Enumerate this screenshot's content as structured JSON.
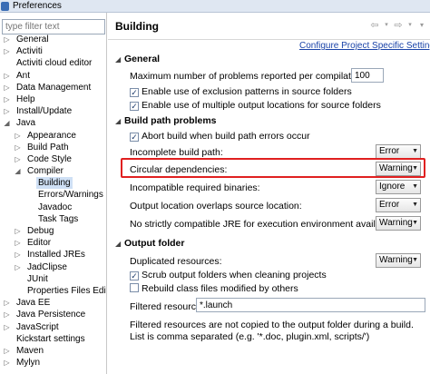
{
  "window": {
    "title": "Preferences"
  },
  "filter": {
    "placeholder": "type filter text"
  },
  "tree": [
    {
      "label": "General",
      "depth": 0,
      "arrow": "▷"
    },
    {
      "label": "Activiti",
      "depth": 0,
      "arrow": "▷"
    },
    {
      "label": "Activiti cloud editor",
      "depth": 0,
      "arrow": ""
    },
    {
      "label": "Ant",
      "depth": 0,
      "arrow": "▷"
    },
    {
      "label": "Data Management",
      "depth": 0,
      "arrow": "▷"
    },
    {
      "label": "Help",
      "depth": 0,
      "arrow": "▷"
    },
    {
      "label": "Install/Update",
      "depth": 0,
      "arrow": "▷"
    },
    {
      "label": "Java",
      "depth": 0,
      "arrow": "◢"
    },
    {
      "label": "Appearance",
      "depth": 1,
      "arrow": "▷"
    },
    {
      "label": "Build Path",
      "depth": 1,
      "arrow": "▷"
    },
    {
      "label": "Code Style",
      "depth": 1,
      "arrow": "▷"
    },
    {
      "label": "Compiler",
      "depth": 1,
      "arrow": "◢"
    },
    {
      "label": "Building",
      "depth": 2,
      "arrow": "",
      "selected": true
    },
    {
      "label": "Errors/Warnings",
      "depth": 2,
      "arrow": ""
    },
    {
      "label": "Javadoc",
      "depth": 2,
      "arrow": ""
    },
    {
      "label": "Task Tags",
      "depth": 2,
      "arrow": ""
    },
    {
      "label": "Debug",
      "depth": 1,
      "arrow": "▷"
    },
    {
      "label": "Editor",
      "depth": 1,
      "arrow": "▷"
    },
    {
      "label": "Installed JREs",
      "depth": 1,
      "arrow": "▷"
    },
    {
      "label": "JadClipse",
      "depth": 1,
      "arrow": "▷"
    },
    {
      "label": "JUnit",
      "depth": 1,
      "arrow": ""
    },
    {
      "label": "Properties Files Edito",
      "depth": 1,
      "arrow": ""
    },
    {
      "label": "Java EE",
      "depth": 0,
      "arrow": "▷"
    },
    {
      "label": "Java Persistence",
      "depth": 0,
      "arrow": "▷"
    },
    {
      "label": "JavaScript",
      "depth": 0,
      "arrow": "▷"
    },
    {
      "label": "Kickstart settings",
      "depth": 0,
      "arrow": ""
    },
    {
      "label": "Maven",
      "depth": 0,
      "arrow": "▷"
    },
    {
      "label": "Mylyn",
      "depth": 0,
      "arrow": "▷"
    }
  ],
  "page": {
    "title": "Building",
    "config_link": "Configure Project Specific Settings...",
    "general": {
      "header": "General",
      "max_problems_label": "Maximum number of problems reported per compilation unit:",
      "max_problems_value": "100",
      "exclusion_label": "Enable use of exclusion patterns in source folders",
      "multiple_output_label": "Enable use of multiple output locations for source folders"
    },
    "build_path": {
      "header": "Build path problems",
      "abort_label": "Abort build when build path errors occur",
      "incomplete_label": "Incomplete build path:",
      "incomplete_value": "Error",
      "circular_label": "Circular dependencies:",
      "circular_value": "Warning",
      "incompatible_label": "Incompatible required binaries:",
      "incompatible_value": "Ignore",
      "overlap_label": "Output location overlaps source location:",
      "overlap_value": "Error",
      "jre_label": "No strictly compatible JRE for execution environment available:",
      "jre_value": "Warning"
    },
    "output": {
      "header": "Output folder",
      "duplicated_label": "Duplicated resources:",
      "duplicated_value": "Warning",
      "scrub_label": "Scrub output folders when cleaning projects",
      "rebuild_label": "Rebuild class files modified by others",
      "filtered_label": "Filtered resources:",
      "filtered_value": "*.launch",
      "note": "Filtered resources are not copied to the output folder during a build. List is comma separated (e.g. '*.doc, plugin.xml, scripts/')"
    }
  },
  "colors": {
    "highlight": "#e02020",
    "link": "#1a43a8",
    "selection": "#cfe0f5"
  }
}
